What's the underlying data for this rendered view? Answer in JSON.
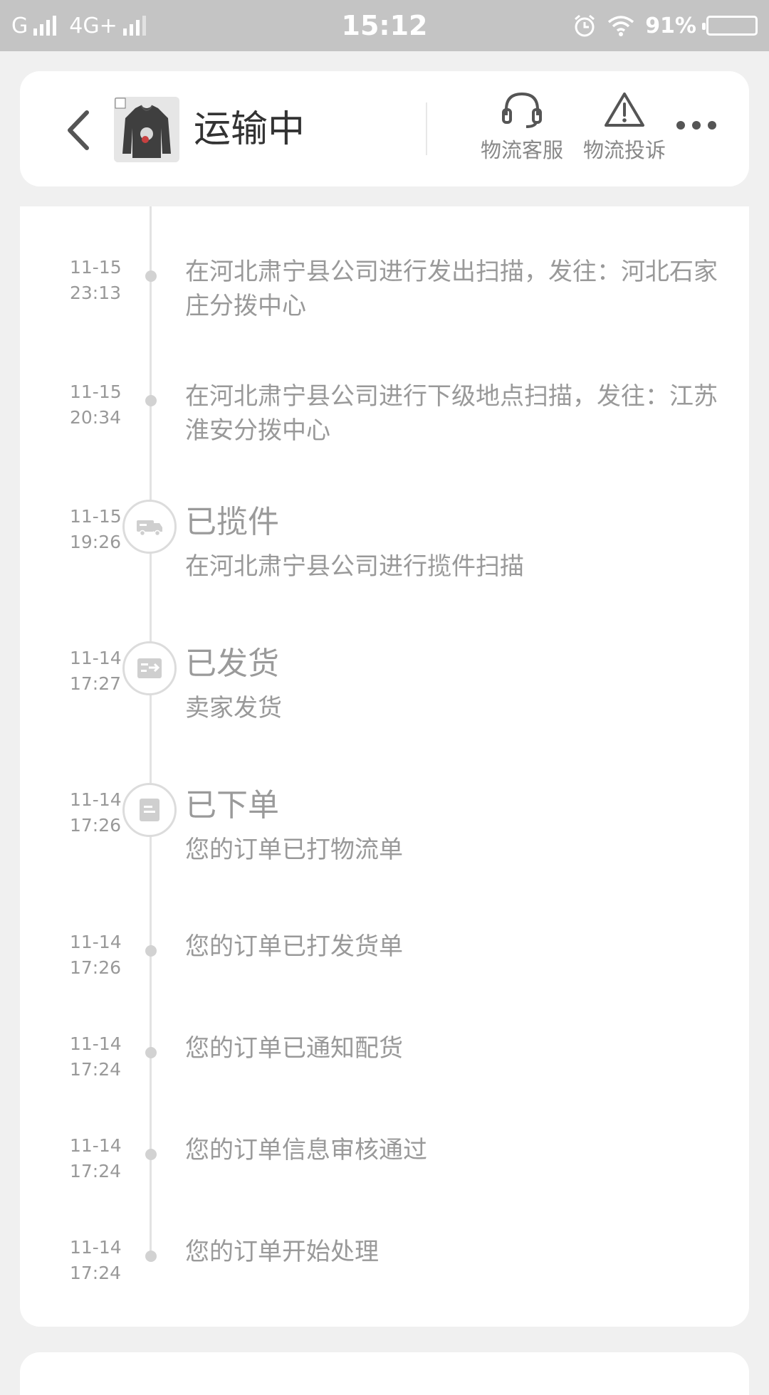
{
  "status_bar": {
    "carrier1": "G",
    "carrier2": "4G+",
    "time": "15:12",
    "battery": "91%"
  },
  "header": {
    "title": "运输中",
    "service_label": "物流客服",
    "complaint_label": "物流投诉"
  },
  "timeline": [
    {
      "date": "11-15",
      "time": "23:13",
      "desc": "在河北肃宁县公司进行发出扫描，发往：河北石家庄分拨中心"
    },
    {
      "date": "11-15",
      "time": "20:34",
      "desc": "在河北肃宁县公司进行下级地点扫描，发往：江苏淮安分拨中心"
    },
    {
      "date": "11-15",
      "time": "19:26",
      "status": "已揽件",
      "desc": "在河北肃宁县公司进行揽件扫描",
      "icon": "truck-icon"
    },
    {
      "date": "11-14",
      "time": "17:27",
      "status": "已发货",
      "desc": "卖家发货",
      "icon": "ship-icon"
    },
    {
      "date": "11-14",
      "time": "17:26",
      "status": "已下单",
      "desc": "您的订单已打物流单",
      "icon": "document-icon"
    },
    {
      "date": "11-14",
      "time": "17:26",
      "desc": "您的订单已打发货单"
    },
    {
      "date": "11-14",
      "time": "17:24",
      "desc": "您的订单已通知配货"
    },
    {
      "date": "11-14",
      "time": "17:24",
      "desc": "您的订单信息审核通过"
    },
    {
      "date": "11-14",
      "time": "17:24",
      "desc": "您的订单开始处理"
    }
  ],
  "colors": {
    "status_bar_bg": "#c4c4c4",
    "page_bg": "#f0f0f0",
    "text_muted": "#999999",
    "title_text": "#333333"
  }
}
